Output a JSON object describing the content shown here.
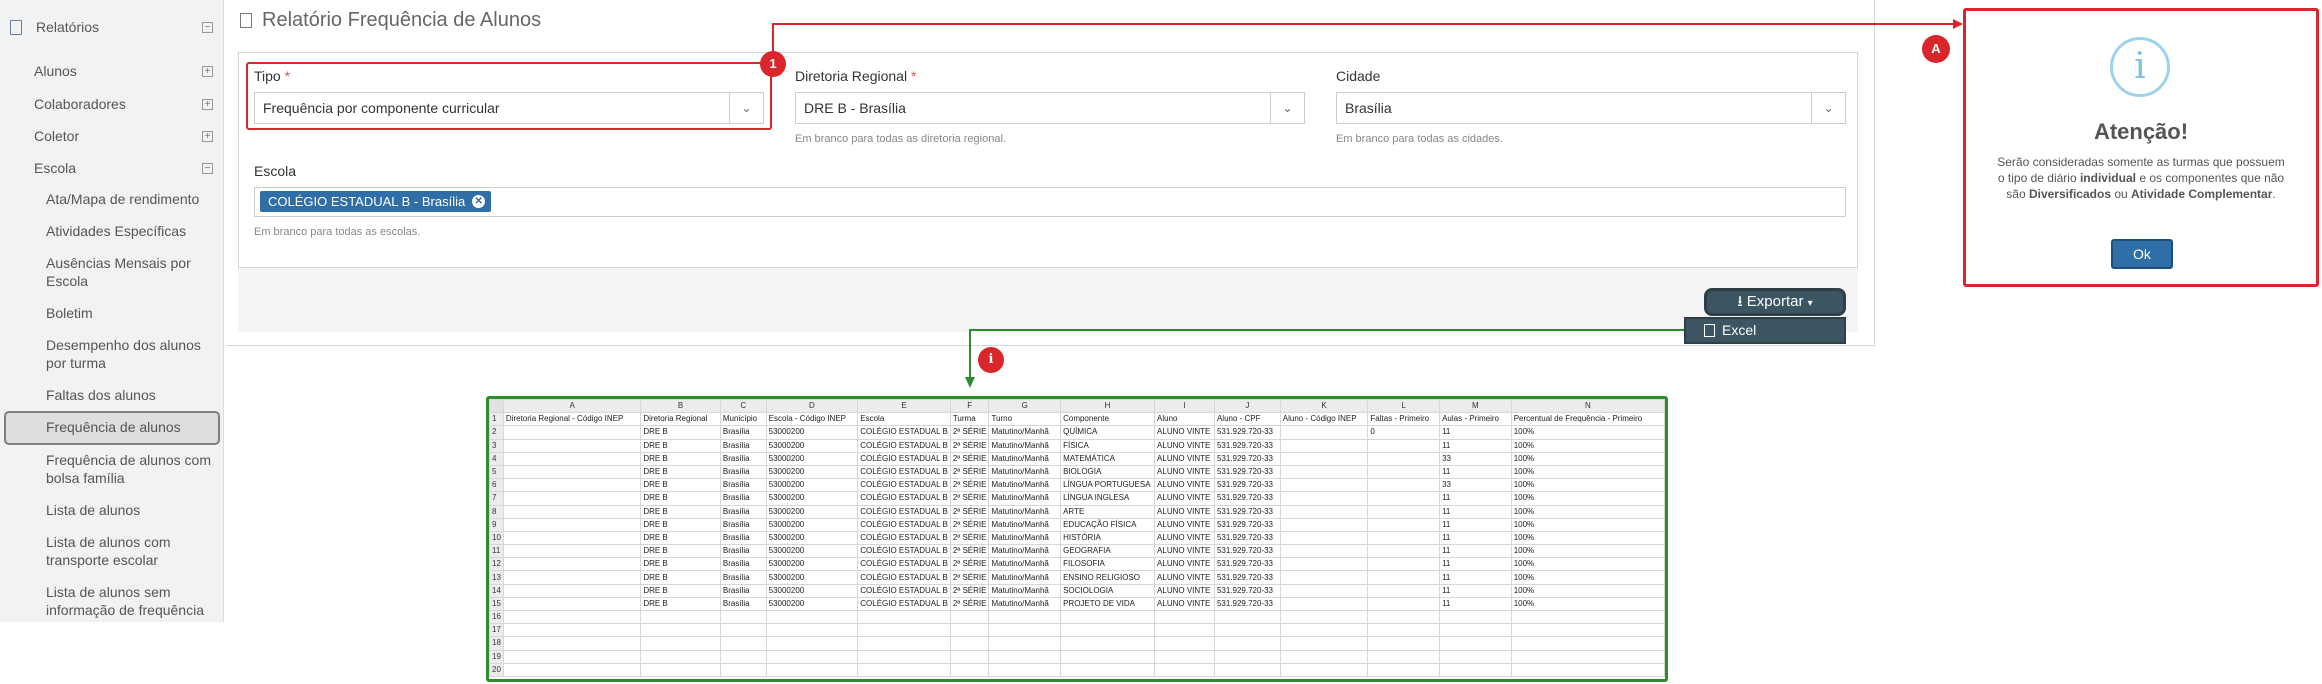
{
  "sidebar": {
    "header": "Relatórios",
    "items": [
      {
        "label": "Alunos",
        "toggle": "+"
      },
      {
        "label": "Colaboradores",
        "toggle": "+"
      },
      {
        "label": "Coletor",
        "toggle": "+"
      },
      {
        "label": "Escola",
        "toggle": "−"
      }
    ],
    "sub_items": [
      "Ata/Mapa de rendimento",
      "Atividades Específicas",
      "Ausências Mensais por Escola",
      "Boletim",
      "Desempenho dos alunos por turma",
      "Faltas dos alunos",
      "Frequência de alunos",
      "Frequência de alunos com bolsa família",
      "Lista de alunos",
      "Lista de alunos com transporte escolar",
      "Lista de alunos sem informação de frequência"
    ],
    "header_toggle": "−"
  },
  "page": {
    "title": "Relatório Frequência de Alunos",
    "tipo_label": "Tipo",
    "tipo_value": "Frequência por componente curricular",
    "dre_label": "Diretoria Regional",
    "dre_value": "DRE B - Brasília",
    "dre_help": "Em branco para todas as diretoria regional.",
    "cidade_label": "Cidade",
    "cidade_value": "Brasília",
    "cidade_help": "Em branco para todas as cidades.",
    "escola_label": "Escola",
    "escola_tag": "COLÉGIO ESTADUAL B - Brasília",
    "escola_help": "Em branco para todas as escolas.",
    "required_mark": "*",
    "export_label": "Exportar",
    "excel_label": "Excel"
  },
  "callouts": {
    "one": "1",
    "a": "A",
    "i": "i"
  },
  "modal": {
    "title": "Atenção!",
    "text_1": "Serão consideradas somente as turmas que possuem o tipo de diário ",
    "bold_1": "individual",
    "text_2": " e os componentes que não são ",
    "bold_2": "Diversificados",
    "text_3": " ou ",
    "bold_3": "Atividade Complementar",
    "text_4": ".",
    "ok": "Ok"
  },
  "sheet": {
    "columns": [
      "A",
      "B",
      "C",
      "D",
      "E",
      "F",
      "G",
      "H",
      "I",
      "J",
      "K",
      "L",
      "M",
      "N"
    ],
    "col_widths": [
      138,
      80,
      46,
      92,
      92,
      38,
      72,
      94,
      60,
      66,
      88,
      72,
      72,
      154
    ],
    "header_row": [
      "Diretoria Regional - Código INEP",
      "Diretoria Regional",
      "Município",
      "Escola - Código INEP",
      "Escola",
      "Turma",
      "Turno",
      "Componente",
      "Aluno",
      "Aluno - CPF",
      "Aluno - Código INEP",
      "Faltas - Primeiro",
      "Aulas - Primeiro",
      "Percentual de Frequência - Primeiro"
    ],
    "rows": [
      [
        "",
        "DRE B",
        "Brasília",
        "53000200",
        "COLÉGIO ESTADUAL B",
        "2ª SÉRIE",
        "Matutino/Manhã",
        "QUÍMICA",
        "ALUNO VINTE",
        "531.929.720-33",
        "",
        "0",
        "11",
        "100%"
      ],
      [
        "",
        "DRE B",
        "Brasília",
        "53000200",
        "COLÉGIO ESTADUAL B",
        "2ª SÉRIE",
        "Matutino/Manhã",
        "FÍSICA",
        "ALUNO VINTE",
        "531.929.720-33",
        "",
        "",
        "11",
        "100%"
      ],
      [
        "",
        "DRE B",
        "Brasília",
        "53000200",
        "COLÉGIO ESTADUAL B",
        "2ª SÉRIE",
        "Matutino/Manhã",
        "MATEMÁTICA",
        "ALUNO VINTE",
        "531.929.720-33",
        "",
        "",
        "33",
        "100%"
      ],
      [
        "",
        "DRE B",
        "Brasília",
        "53000200",
        "COLÉGIO ESTADUAL B",
        "2ª SÉRIE",
        "Matutino/Manhã",
        "BIOLOGIA",
        "ALUNO VINTE",
        "531.929.720-33",
        "",
        "",
        "11",
        "100%"
      ],
      [
        "",
        "DRE B",
        "Brasília",
        "53000200",
        "COLÉGIO ESTADUAL B",
        "2ª SÉRIE",
        "Matutino/Manhã",
        "LÍNGUA PORTUGUESA",
        "ALUNO VINTE",
        "531.929.720-33",
        "",
        "",
        "33",
        "100%"
      ],
      [
        "",
        "DRE B",
        "Brasília",
        "53000200",
        "COLÉGIO ESTADUAL B",
        "2ª SÉRIE",
        "Matutino/Manhã",
        "LÍNGUA INGLESA",
        "ALUNO VINTE",
        "531.929.720-33",
        "",
        "",
        "11",
        "100%"
      ],
      [
        "",
        "DRE B",
        "Brasília",
        "53000200",
        "COLÉGIO ESTADUAL B",
        "2ª SÉRIE",
        "Matutino/Manhã",
        "ARTE",
        "ALUNO VINTE",
        "531.929.720-33",
        "",
        "",
        "11",
        "100%"
      ],
      [
        "",
        "DRE B",
        "Brasília",
        "53000200",
        "COLÉGIO ESTADUAL B",
        "2ª SÉRIE",
        "Matutino/Manhã",
        "EDUCAÇÃO FÍSICA",
        "ALUNO VINTE",
        "531.929.720-33",
        "",
        "",
        "11",
        "100%"
      ],
      [
        "",
        "DRE B",
        "Brasília",
        "53000200",
        "COLÉGIO ESTADUAL B",
        "2ª SÉRIE",
        "Matutino/Manhã",
        "HISTÓRIA",
        "ALUNO VINTE",
        "531.929.720-33",
        "",
        "",
        "11",
        "100%"
      ],
      [
        "",
        "DRE B",
        "Brasília",
        "53000200",
        "COLÉGIO ESTADUAL B",
        "2ª SÉRIE",
        "Matutino/Manhã",
        "GEOGRAFIA",
        "ALUNO VINTE",
        "531.929.720-33",
        "",
        "",
        "11",
        "100%"
      ],
      [
        "",
        "DRE B",
        "Brasília",
        "53000200",
        "COLÉGIO ESTADUAL B",
        "2ª SÉRIE",
        "Matutino/Manhã",
        "FILOSOFIA",
        "ALUNO VINTE",
        "531.929.720-33",
        "",
        "",
        "11",
        "100%"
      ],
      [
        "",
        "DRE B",
        "Brasília",
        "53000200",
        "COLÉGIO ESTADUAL B",
        "2ª SÉRIE",
        "Matutino/Manhã",
        "ENSINO RELIGIOSO",
        "ALUNO VINTE",
        "531.929.720-33",
        "",
        "",
        "11",
        "100%"
      ],
      [
        "",
        "DRE B",
        "Brasília",
        "53000200",
        "COLÉGIO ESTADUAL B",
        "2ª SÉRIE",
        "Matutino/Manhã",
        "SOCIOLOGIA",
        "ALUNO VINTE",
        "531.929.720-33",
        "",
        "",
        "11",
        "100%"
      ],
      [
        "",
        "DRE B",
        "Brasília",
        "53000200",
        "COLÉGIO ESTADUAL B",
        "2ª SÉRIE",
        "Matutino/Manhã",
        "PROJETO DE VIDA",
        "ALUNO VINTE",
        "531.929.720-33",
        "",
        "",
        "11",
        "100%"
      ]
    ],
    "empty_rows": [
      16,
      17,
      18,
      19,
      20
    ]
  },
  "colors": {
    "accent_red": "#d9262b",
    "accent_green": "#2e8b2e",
    "primary_blue": "#2f6ea6",
    "export_dark": "#3b5563"
  }
}
